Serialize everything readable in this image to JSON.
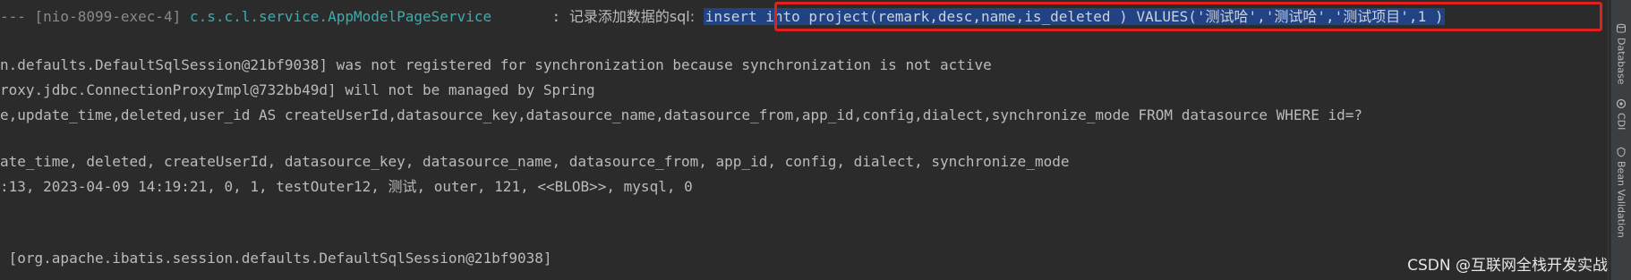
{
  "console": {
    "line1": {
      "thread": "--- [nio-8099-exec-4]",
      "logger": "c.s.c.l.service.AppModelPageService",
      "separator": ":",
      "message_prefix": "记录添加数据的sql:",
      "sql": "insert into project(remark,desc,name,is_deleted ) VALUES('测试哈','测试哈','测试项目',1 )"
    },
    "line2": "n.defaults.DefaultSqlSession@21bf9038] was not registered for synchronization because synchronization is not active",
    "line3": "roxy.jdbc.ConnectionProxyImpl@732bb49d] will not be managed by Spring",
    "line4": "e,update_time,deleted,user_id AS createUserId,datasource_key,datasource_name,datasource_from,app_id,config,dialect,synchronize_mode FROM datasource WHERE id=?",
    "line5": "ate_time, deleted, createUserId, datasource_key, datasource_name, datasource_from, app_id, config, dialect, synchronize_mode",
    "line6": ":13, 2023-04-09 14:19:21, 0, 1, testOuter12, 测试, outer, 121, <<BLOB>>, mysql, 0",
    "line7": " [org.apache.ibatis.session.defaults.DefaultSqlSession@21bf9038]"
  },
  "sidebar": {
    "tabs": [
      {
        "label": "Database",
        "icon": "database-icon"
      },
      {
        "label": "CDI",
        "icon": "cdi-icon"
      },
      {
        "label": "Bean Validation",
        "icon": "bean-validation-icon"
      }
    ]
  },
  "watermark": "CSDN @互联网全栈开发实战",
  "colors": {
    "background": "#2b2b2b",
    "logger": "#3dabae",
    "selection": "#214283",
    "highlight_box": "#e0201c"
  }
}
